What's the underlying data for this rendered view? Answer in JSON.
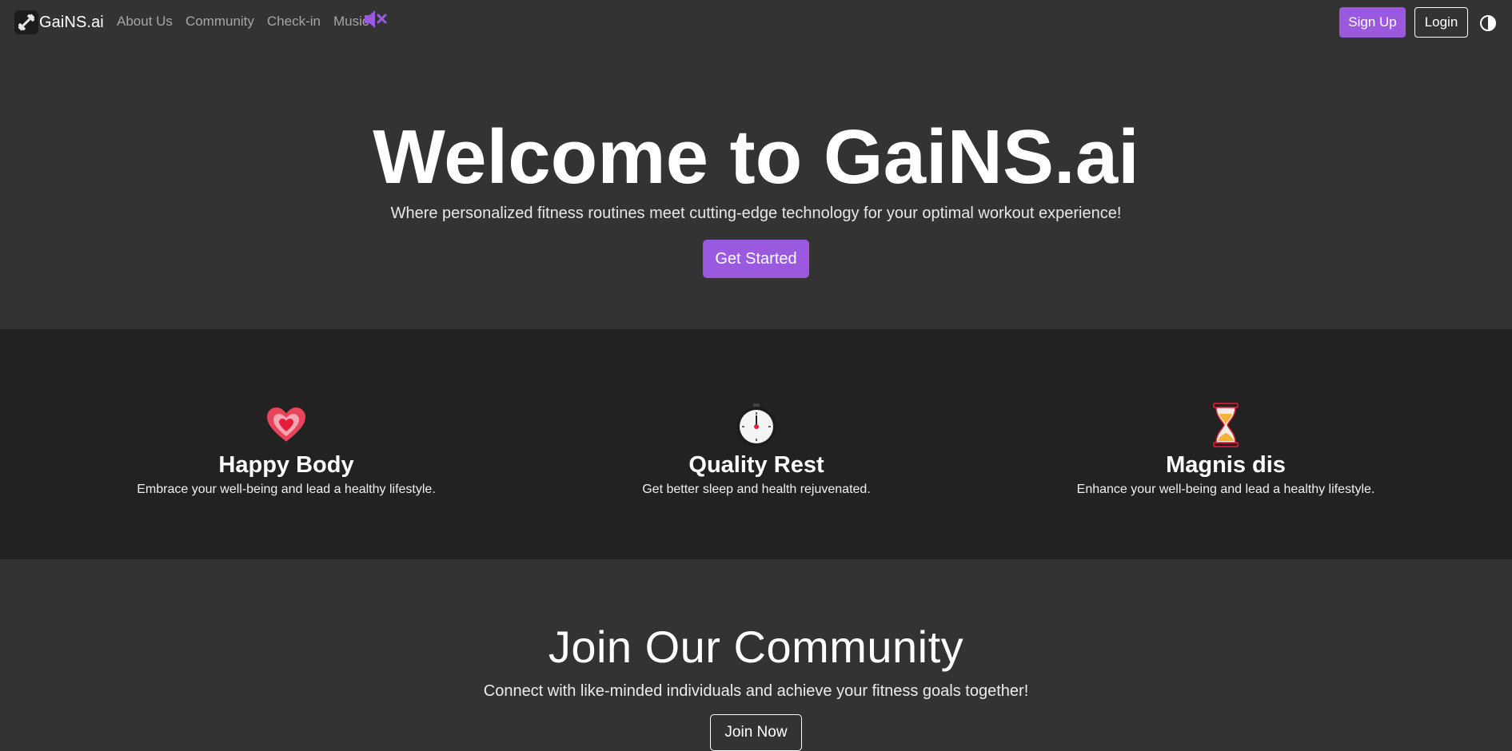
{
  "nav": {
    "brand": "GaiNS.ai",
    "brand_icon": "dumbbell-icon",
    "links": [
      "About Us",
      "Community",
      "Check-in",
      "Music"
    ],
    "mute_icon": "speaker-muted-icon",
    "signup_label": "Sign Up",
    "login_label": "Login",
    "theme_icon": "contrast-toggle-icon"
  },
  "hero": {
    "title": "Welcome to GaiNS.ai",
    "subtitle": "Where personalized fitness routines meet cutting-edge technology for your optimal workout experience!",
    "cta_label": "Get Started"
  },
  "features": [
    {
      "icon": "heart-icon",
      "title": "Happy Body",
      "description": "Embrace your well-being and lead a healthy lifestyle."
    },
    {
      "icon": "stopwatch-icon",
      "title": "Quality Rest",
      "description": "Get better sleep and health rejuvenated."
    },
    {
      "icon": "hourglass-icon",
      "title": "Magnis dis",
      "description": "Enhance your well-being and lead a healthy lifestyle."
    }
  ],
  "community": {
    "title": "Join Our Community",
    "subtitle": "Connect with like-minded individuals and achieve your fitness goals together!",
    "cta_label": "Join Now"
  },
  "colors": {
    "page_bg": "#333333",
    "features_bg": "#222222",
    "accent": "#9b59e0",
    "nav_link": "#a6a6a6",
    "text": "#ffffff"
  }
}
